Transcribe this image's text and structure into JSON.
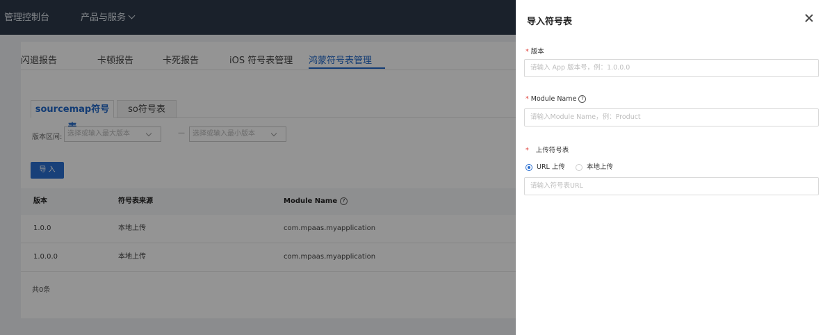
{
  "header": {
    "brand": "管理控制台",
    "products": "产品与服务"
  },
  "tabs": [
    {
      "label": "闪退报告"
    },
    {
      "label": "卡顿报告"
    },
    {
      "label": "卡死报告"
    },
    {
      "label": "iOS 符号表管理"
    },
    {
      "label": "鸿蒙符号表管理",
      "active": true
    }
  ],
  "subtabs": [
    {
      "label": "sourcemap符号表",
      "active": true
    },
    {
      "label": "so符号表"
    }
  ],
  "filter": {
    "label": "版本区间:",
    "max_placeholder": "选择或输入最大版本",
    "separator": "—",
    "min_placeholder": "选择或输入最小版本"
  },
  "import_button": "导 入",
  "table": {
    "columns": [
      "版本",
      "符号表来源",
      "Module Name"
    ],
    "rows": [
      [
        "1.0.0",
        "本地上传",
        "com.mpaas.myapplication"
      ],
      [
        "1.0.0.0",
        "本地上传",
        "com.mpaas.myapplication"
      ]
    ],
    "total": "共0条"
  },
  "drawer": {
    "title": "导入符号表",
    "version_label": "版本",
    "version_placeholder": "请输入 App 版本号，例：1.0.0.0",
    "module_label": "Module Name",
    "module_placeholder": "请输入Module Name，例：Product",
    "upload_label": "上传符号表",
    "radio_url": "URL 上传",
    "radio_local": "本地上传",
    "url_placeholder": "请输入符号表URL",
    "required_mark": "*",
    "help_glyph": "?"
  },
  "colors": {
    "accent": "#2a6fd1",
    "header": "#2d3a4b",
    "required": "#e0403a"
  }
}
